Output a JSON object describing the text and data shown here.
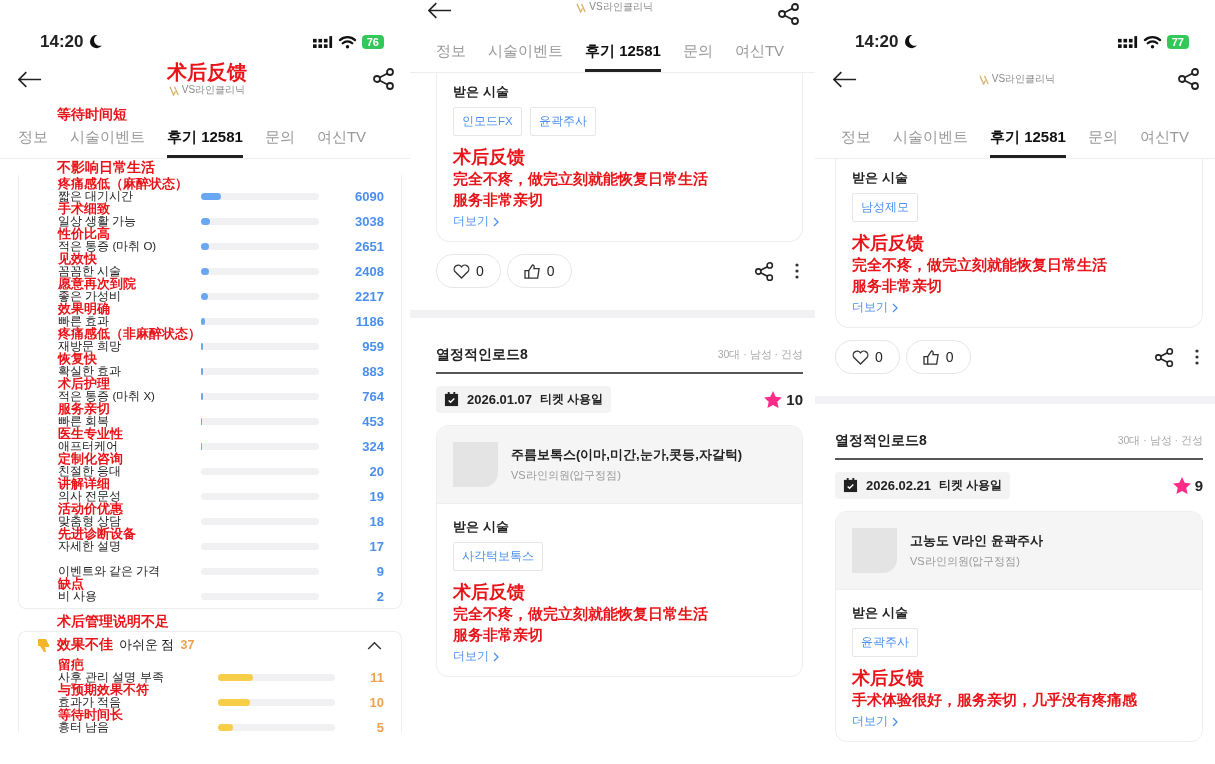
{
  "phones": [
    {
      "kind": "stats",
      "status_bar": {
        "time": "14:20",
        "battery": "76"
      },
      "header": {
        "annotation": "术后反馈",
        "logo": "VS라인클리닉",
        "cropped": false
      },
      "tab_annotations": [
        "等待时间短",
        "不影响日常生活"
      ],
      "tabs": [
        {
          "label": "정보",
          "selected": false
        },
        {
          "label": "시술이벤트",
          "selected": false
        },
        {
          "label": "후기 12581",
          "selected": true
        },
        {
          "label": "문의",
          "selected": false
        },
        {
          "label": "여신TV",
          "selected": false
        }
      ],
      "positive": {
        "rows": [
          {
            "annotation": "疼痛感低（麻醉状态）",
            "label": "짧은 대기시간",
            "count": "6090",
            "level": 0.17
          },
          {
            "annotation": "手术细致",
            "label": "일상 생활 가능",
            "count": "3038",
            "level": 0.08
          },
          {
            "annotation": "性价比高",
            "label": "적은 통증 (마취 O)",
            "count": "2651",
            "level": 0.07
          },
          {
            "annotation": "见效快",
            "label": "꼼꼼한 시술",
            "count": "2408",
            "level": 0.07
          },
          {
            "annotation": "愿意再次到院",
            "label": "좋은 가성비",
            "count": "2217",
            "level": 0.06
          },
          {
            "annotation": "效果明确",
            "label": "빠른 효과",
            "count": "1186",
            "level": 0.03
          },
          {
            "annotation": "疼痛感低（非麻醉状态）",
            "label": "재방문 희망",
            "count": "959",
            "level": 0.02
          },
          {
            "annotation": "恢复快",
            "label": "확실한 효과",
            "count": "883",
            "level": 0.02
          },
          {
            "annotation": "术后护理",
            "label": "적은 통증 (마취 X)",
            "count": "764",
            "level": 0.02
          },
          {
            "annotation": "服务亲切",
            "label": "빠른 회복",
            "count": "453",
            "level": 0.01
          },
          {
            "annotation": "医生专业性",
            "label": "애프터케어",
            "count": "324",
            "level": 0.01
          },
          {
            "annotation": "定制化咨询",
            "label": "친절한 응대",
            "count": "20"
          },
          {
            "annotation": "讲解详细",
            "label": "의사 전문성",
            "count": "19"
          },
          {
            "annotation": "活动价优惠",
            "label": "맞춤형 상담",
            "count": "18"
          },
          {
            "annotation": "先进诊断设备",
            "label": "자세한 설명",
            "count": "17"
          },
          {
            "label": "이벤트와 같은 가격",
            "count": "9"
          },
          {
            "annotation": "缺点",
            "label": "비 사용",
            "count": "2"
          }
        ]
      },
      "negative_note": "术后管理说明不足",
      "negative": {
        "annotation": "效果不佳",
        "title": "아쉬운 점",
        "count": "37",
        "expanded": true,
        "rows": [
          {
            "annotation": "留疤",
            "label": "사후 관리 설명 부족",
            "count": "11",
            "level": 0.3
          },
          {
            "annotation": "与预期效果不符",
            "label": "효과가 적음",
            "count": "10",
            "level": 0.27
          },
          {
            "annotation": "等待时间长",
            "label": "흉터 남음",
            "count": "5",
            "level": 0.13
          }
        ]
      }
    },
    {
      "kind": "reviews",
      "header": {
        "logo": "VS라인클리닉",
        "cropped": true
      },
      "tabs": [
        {
          "label": "정보",
          "selected": false
        },
        {
          "label": "시술이벤트",
          "selected": false
        },
        {
          "label": "후기 12581",
          "selected": true
        },
        {
          "label": "문의",
          "selected": false
        },
        {
          "label": "여신TV",
          "selected": false
        }
      ],
      "top_review": {
        "tags_title": "받은 시술",
        "tags": [
          "인모드FX",
          "윤곽주사"
        ],
        "feedback_title": "术后反馈",
        "feedback_lines": [
          "完全不疼，做完立刻就能恢复日常生活",
          "服务非常亲切"
        ],
        "more": "더보기",
        "likes": "0",
        "thumbs": "0"
      },
      "review": {
        "author": "열정적인로드8",
        "meta": "30대 · 남성 · 건성",
        "date": "2026.01.07",
        "date_label": "티켓 사용일",
        "rating": "10",
        "product": "주름보톡스(이마,미간,눈가,콧등,자갈턱)",
        "clinic": "VS라인의원(압구정점)",
        "tags_title": "받은 시술",
        "tags": [
          "사각턱보톡스"
        ],
        "feedback_title": "术后反馈",
        "feedback_lines": [
          "完全不疼，做完立刻就能恢复日常生活",
          "服务非常亲切"
        ],
        "more": "더보기"
      }
    },
    {
      "kind": "reviews",
      "status_bar": {
        "time": "14:20",
        "battery": "77"
      },
      "header": {
        "logo": "VS라인클리닉",
        "cropped": false
      },
      "tabs": [
        {
          "label": "정보",
          "selected": false
        },
        {
          "label": "시술이벤트",
          "selected": false
        },
        {
          "label": "후기 12581",
          "selected": true
        },
        {
          "label": "문의",
          "selected": false
        },
        {
          "label": "여신TV",
          "selected": false
        }
      ],
      "top_review": {
        "tags_title": "받은 시술",
        "tags": [
          "남성제모"
        ],
        "feedback_title": "术后反馈",
        "feedback_lines": [
          "完全不疼，做完立刻就能恢复日常生活",
          "服务非常亲切"
        ],
        "more": "더보기",
        "likes": "0",
        "thumbs": "0"
      },
      "review": {
        "author": "열정적인로드8",
        "meta": "30대 · 남성 · 건성",
        "date": "2026.02.21",
        "date_label": "티켓 사용일",
        "rating": "9",
        "product": "고농도 V라인 윤곽주사",
        "clinic": "VS라인의원(압구정점)",
        "tags_title": "받은 시술",
        "tags": [
          "윤곽주사"
        ],
        "feedback_title": "术后反馈",
        "feedback_lines": [
          "手术体验很好，服务亲切，几乎没有疼痛感"
        ],
        "more": "더보기"
      }
    }
  ]
}
